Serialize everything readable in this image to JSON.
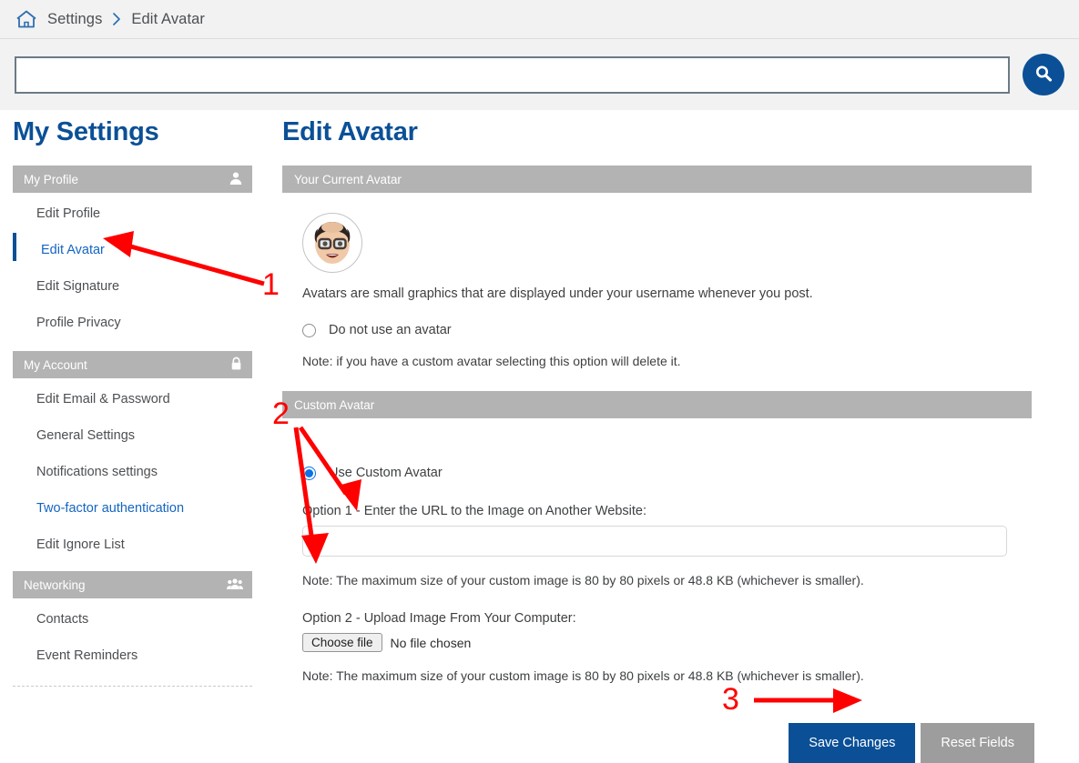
{
  "breadcrumb": {
    "home_icon": "home-icon",
    "items": [
      "Settings",
      "Edit Avatar"
    ],
    "separator": "chevron-right-icon"
  },
  "search": {
    "value": "",
    "placeholder": "",
    "button_icon": "search-icon",
    "button_color": "#0b5097"
  },
  "sidebar": {
    "title": "My Settings",
    "groups": [
      {
        "header": "My Profile",
        "icon": "person-icon",
        "items": [
          {
            "label": "Edit Profile",
            "state": "normal"
          },
          {
            "label": "Edit Avatar",
            "state": "active"
          },
          {
            "label": "Edit Signature",
            "state": "normal"
          },
          {
            "label": "Profile Privacy",
            "state": "normal"
          }
        ]
      },
      {
        "header": "My Account",
        "icon": "lock-icon",
        "items": [
          {
            "label": "Edit Email & Password",
            "state": "normal"
          },
          {
            "label": "General Settings",
            "state": "normal"
          },
          {
            "label": "Notifications settings",
            "state": "normal"
          },
          {
            "label": "Two-factor authentication",
            "state": "link"
          },
          {
            "label": "Edit Ignore List",
            "state": "normal"
          }
        ]
      },
      {
        "header": "Networking",
        "icon": "people-icon",
        "items": [
          {
            "label": "Contacts",
            "state": "normal"
          },
          {
            "label": "Event Reminders",
            "state": "normal"
          }
        ]
      }
    ]
  },
  "main": {
    "title": "Edit Avatar",
    "current_avatar_panel": {
      "header": "Your Current Avatar",
      "avatar_icon": "memoji-avatar",
      "description": "Avatars are small graphics that are displayed under your username whenever you post.",
      "no_avatar_radio": {
        "label": "Do not use an avatar",
        "checked": false
      },
      "note": "Note: if you have a custom avatar selecting this option will delete it."
    },
    "custom_avatar_panel": {
      "header": "Custom Avatar",
      "use_custom_radio": {
        "label": "Use Custom Avatar",
        "checked": true
      },
      "option1_label": "Option 1 - Enter the URL to the Image on Another Website:",
      "url_value": "",
      "url_placeholder": "",
      "option1_note": "Note: The maximum size of your custom image is 80 by 80 pixels or 48.8 KB (whichever is smaller).",
      "option2_label": "Option 2 - Upload Image From Your Computer:",
      "choose_file_label": "Choose file",
      "file_status": "No file chosen",
      "option2_note": "Note: The maximum size of your custom image is 80 by 80 pixels or 48.8 KB (whichever is smaller)."
    },
    "buttons": {
      "save_label": "Save Changes",
      "reset_label": "Reset Fields",
      "save_color": "#0b5097",
      "reset_color": "#9d9d9d"
    }
  },
  "annotations": {
    "color": "#ff0000",
    "markers": [
      {
        "number": "1",
        "target": "sidebar-item-edit-avatar"
      },
      {
        "number": "2",
        "target": "custom-avatar-inputs"
      },
      {
        "number": "3",
        "target": "save-changes-button"
      }
    ]
  }
}
